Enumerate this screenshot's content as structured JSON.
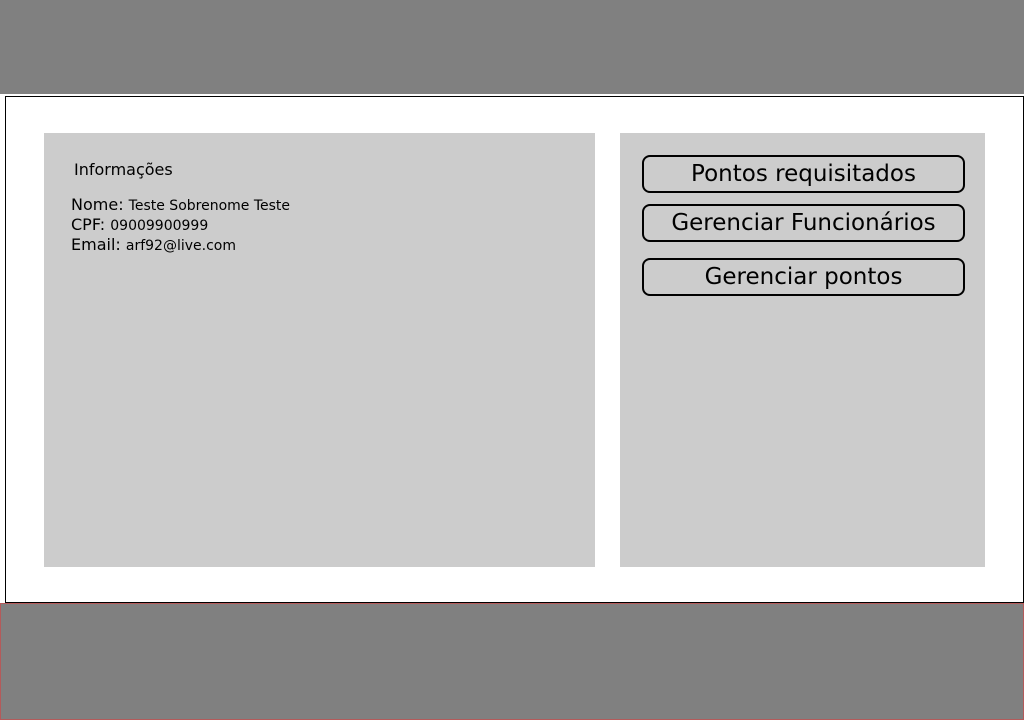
{
  "info": {
    "title": "Informações",
    "name_label": "Nome:",
    "name_value": "Teste Sobrenome Teste",
    "cpf_label": "CPF:",
    "cpf_value": "09009900999",
    "email_label": "Email:",
    "email_value": "arf92@live.com"
  },
  "actions": {
    "pontos_requisitados": "Pontos requisitados",
    "gerenciar_funcionarios": "Gerenciar Funcionários",
    "gerenciar_pontos": "Gerenciar pontos"
  },
  "colors": {
    "header_bg": "#808080",
    "panel_bg": "#cccccc",
    "page_bg": "#ffffff"
  }
}
